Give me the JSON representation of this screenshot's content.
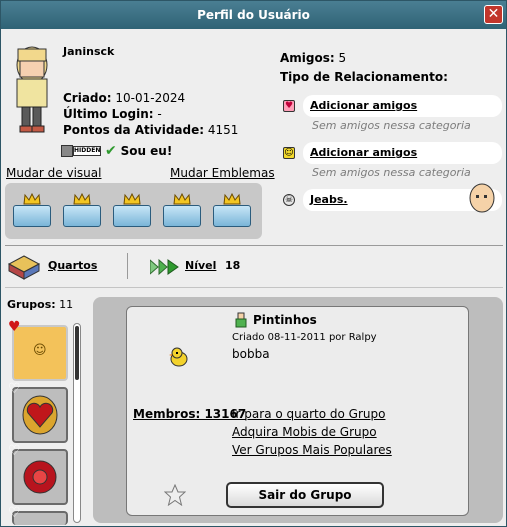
{
  "window": {
    "title": "Perfil do Usuário",
    "close_glyph": "✕"
  },
  "profile": {
    "username": "Janinsck",
    "created_label": "Criado:",
    "created_value": "10-01-2024",
    "last_login_label": "Último Login:",
    "last_login_value": "-",
    "activity_label": "Pontos da Atividade:",
    "activity_value": "4151",
    "hidden_badge": "HIDDEN",
    "sou_eu": "Sou eu!",
    "change_look": "Mudar de visual",
    "change_badges": "Mudar Emblemas"
  },
  "relationships": {
    "friends_label": "Amigos:",
    "friends_count": "5",
    "type_title": "Tipo de Relacionamento:",
    "rows": [
      {
        "icon": "heart-icon",
        "label": "Adicionar amigos",
        "empty": "Sem amigos nessa categoria"
      },
      {
        "icon": "smile-icon",
        "label": "Adicionar amigos",
        "empty": "Sem amigos nessa categoria"
      },
      {
        "icon": "skull-icon",
        "label": "Jeabs."
      }
    ]
  },
  "stats": {
    "rooms_label": "Quartos",
    "level_label": "Nível",
    "level_value": "18"
  },
  "groups": {
    "label": "Grupos:",
    "count": "11",
    "selected": {
      "name": "Pintinhos",
      "created": "Criado 08-11-2011 por Ralpy",
      "description": "bobba",
      "members_label": "Membros: 13167",
      "link_room": "Ir para o quarto do Grupo",
      "link_furni": "Adquira Mobis de Grupo",
      "link_popular": "Ver Grupos Mais Populares",
      "leave_button": "Sair do Grupo"
    }
  },
  "colors": {
    "titlebar": "#3d7286",
    "close": "#c2362b",
    "panel": "#bdbdbd"
  }
}
